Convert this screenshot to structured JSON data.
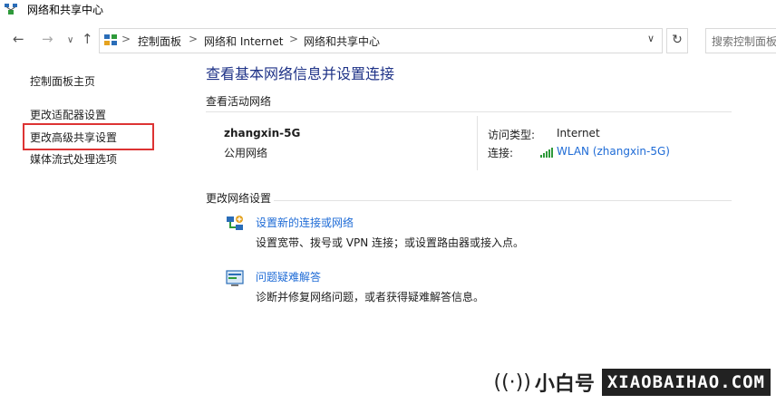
{
  "window": {
    "title": "网络和共享中心",
    "icon": "network-sharing-icon"
  },
  "address": {
    "crumbs": [
      "控制面板",
      "网络和 Internet",
      "网络和共享中心"
    ],
    "separator": ">",
    "search_placeholder": "搜索控制面板"
  },
  "nav": {
    "back": "←",
    "forward": "→",
    "dropdown": "∨",
    "up": "↑",
    "refresh": "↻",
    "addr_dropdown": "∨"
  },
  "sidebar": {
    "items": [
      {
        "label": "控制面板主页"
      },
      {
        "label": "更改适配器设置"
      },
      {
        "label": "更改高级共享设置"
      },
      {
        "label": "媒体流式处理选项"
      }
    ],
    "highlight_color": "#dd3333"
  },
  "main": {
    "title": "查看基本网络信息并设置连接",
    "active_section": "查看活动网络",
    "network": {
      "name": "zhangxin-5G",
      "type": "公用网络",
      "access_type_label": "访问类型:",
      "access_type_value": "Internet",
      "connection_label": "连接:",
      "connection_value": "WLAN (zhangxin-5G)"
    },
    "change_section": "更改网络设置",
    "actions": [
      {
        "link": "设置新的连接或网络",
        "desc": "设置宽带、拨号或 VPN 连接；或设置路由器或接入点。",
        "icon": "new-connection-icon"
      },
      {
        "link": "问题疑难解答",
        "desc": "诊断并修复网络问题，或者获得疑难解答信息。",
        "icon": "troubleshoot-icon"
      }
    ]
  },
  "watermark": {
    "brand": "小白号",
    "domain": "XIAOBAIHAO.COM"
  },
  "colors": {
    "title_blue": "#1e3287",
    "link_blue": "#1e6bd6",
    "signal_green": "#2e9a3a"
  }
}
